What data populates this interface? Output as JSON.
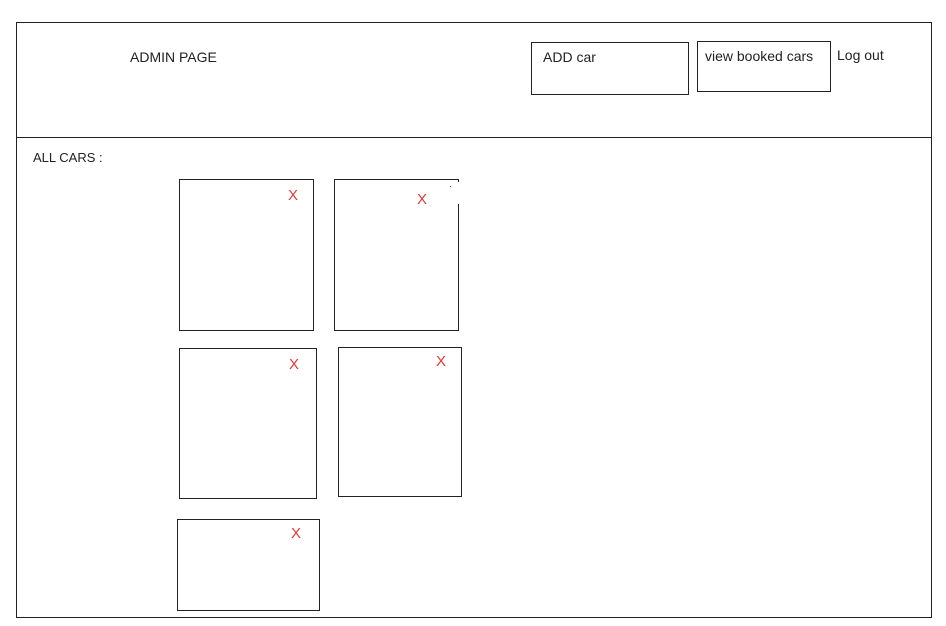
{
  "header": {
    "title": "ADMIN PAGE",
    "add_car_label": "ADD car",
    "view_booked_label": "view booked cars",
    "logout_label": "Log out"
  },
  "main": {
    "section_label": "ALL CARS :",
    "cards": [
      {
        "delete_label": "X"
      },
      {
        "delete_label": "X"
      },
      {
        "delete_label": "X"
      },
      {
        "delete_label": "X"
      },
      {
        "delete_label": "X"
      }
    ]
  },
  "colors": {
    "delete_mark": "#e53935",
    "border": "#222222",
    "background": "#ffffff"
  }
}
